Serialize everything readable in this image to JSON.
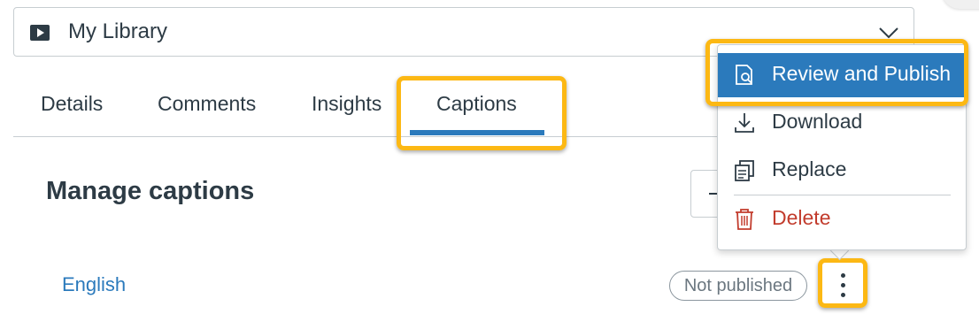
{
  "library": {
    "label": "My Library",
    "icon": "play-icon"
  },
  "tabs": [
    {
      "label": "Details"
    },
    {
      "label": "Comments"
    },
    {
      "label": "Insights"
    },
    {
      "label": "Captions",
      "active": true
    }
  ],
  "page": {
    "title": "Manage captions"
  },
  "captions": [
    {
      "language": "English",
      "status": "Not published"
    }
  ],
  "menu": {
    "items": [
      {
        "label": "Review and Publish",
        "icon": "review-icon",
        "selected": true
      },
      {
        "label": "Download",
        "icon": "download-icon"
      },
      {
        "label": "Replace",
        "icon": "replace-icon"
      },
      {
        "label": "Delete",
        "icon": "trash-icon",
        "danger": true
      }
    ]
  },
  "colors": {
    "accent": "#2b7abc",
    "highlight": "#fcb814",
    "danger": "#c23c2d",
    "text": "#2d3b45"
  }
}
